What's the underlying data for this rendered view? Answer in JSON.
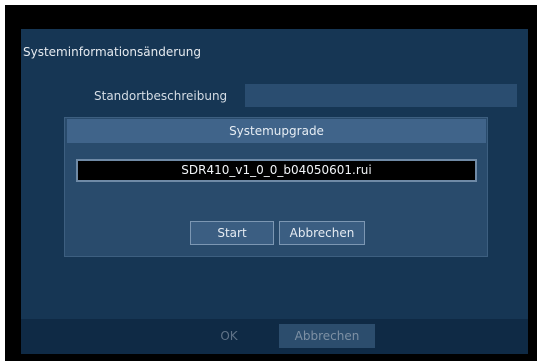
{
  "window": {
    "title": "Systeminformationsänderung"
  },
  "form": {
    "label": "Standortbeschreibung",
    "value": ""
  },
  "popup": {
    "title": "Systemupgrade",
    "filename": "SDR410_v1_0_0_b04050601.rui",
    "start_label": "Start",
    "cancel_label": "Abbrechen"
  },
  "footer": {
    "ok_label": "OK",
    "cancel_label": "Abbrechen"
  },
  "colors": {
    "background_dark": "#163654",
    "dialog_header": "#40648a",
    "popup_panel": "#294b6c",
    "button_fill": "#3b5e82"
  }
}
